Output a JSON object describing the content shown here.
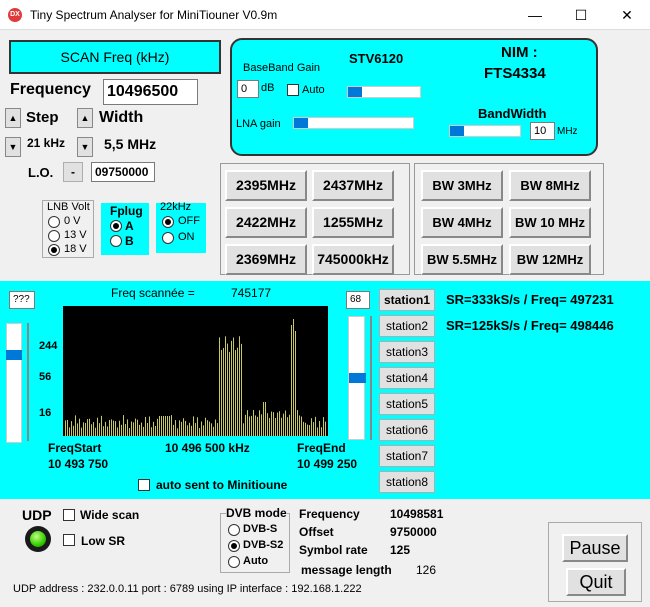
{
  "window": {
    "title": "Tiny Spectrum Analyser for MiniTiouner V0.9m",
    "icon_text": "DX",
    "minimize": "—",
    "maximize": "☐",
    "close": "✕"
  },
  "left": {
    "scan_button": "SCAN Freq (kHz)",
    "frequency_label": "Frequency",
    "frequency_value": "10496500",
    "step_label": "Step",
    "step_value": "21 kHz",
    "width_label": "Width",
    "width_value": "5,5 MHz",
    "lo_label": "L.O.",
    "lo_sign": "-",
    "lo_value": "09750000",
    "lnb_volt_label": "LNB Volt",
    "lnb_options": [
      "0 V",
      "13 V",
      "18 V"
    ],
    "lnb_selected": 2,
    "fplug_label": "Fplug",
    "fplug_options": [
      "A",
      "B"
    ],
    "fplug_selected": 0,
    "k22_label": "22kHz",
    "k22_options": [
      "OFF",
      "ON"
    ],
    "k22_selected": 0
  },
  "tuner": {
    "baseband_label": "BaseBand Gain",
    "baseband_value": "0",
    "baseband_unit": "dB",
    "auto_label": "Auto",
    "stv_label": "STV6120",
    "nim_label": "NIM :",
    "nim_value": "FTS4334",
    "lna_label": "LNA gain",
    "bandwidth_label": "BandWidth",
    "bandwidth_value": "10",
    "bandwidth_unit": "MHz",
    "baseband_slider": 0.0,
    "lna_slider": 0.0,
    "bandwidth_slider": 0.0
  },
  "freq_buttons": [
    "2395MHz",
    "2437MHz",
    "2422MHz",
    "1255MHz",
    "2369MHz",
    "745000kHz"
  ],
  "bw_buttons": [
    "BW 3MHz",
    "BW 8MHz",
    "BW 4MHz",
    "BW 10 MHz",
    "BW 5.5MHz",
    "BW 12MHz"
  ],
  "spectrum": {
    "left_value": "???",
    "freq_scan_label": "Freq scannée =",
    "freq_scan_value": "745177",
    "y_ticks": [
      "244",
      "56",
      "16"
    ],
    "right_value": "68",
    "freq_start_label": "FreqStart",
    "freq_start_value": "10 493 750",
    "center_value": "10 496 500 kHz",
    "freq_end_label": "FreqEnd",
    "freq_end_value": "10 499 250",
    "auto_sent_label": "auto sent to Minitioune",
    "stations": [
      "station1",
      "station2",
      "station3",
      "station4",
      "station5",
      "station6",
      "station7",
      "station8"
    ],
    "results": [
      "SR=333kS/s / Freq= 497231",
      "SR=125kS/s / Freq= 498446"
    ]
  },
  "bottom": {
    "udp_label": "UDP",
    "wide_scan_label": "Wide scan",
    "low_sr_label": "Low SR",
    "dvb_label": "DVB mode",
    "dvb_options": [
      "DVB-S",
      "DVB-S2",
      "Auto"
    ],
    "dvb_selected": 1,
    "info_labels": [
      "Frequency",
      "Offset",
      "Symbol rate",
      "message length"
    ],
    "info_values": [
      "10498581",
      "9750000",
      "125",
      "126"
    ],
    "pause_button": "Pause",
    "quit_button": "Quit",
    "status": "UDP address : 232.0.0.11 port : 6789 using IP interface : 192.168.1.222"
  },
  "colors": {
    "accent": "#00ffff",
    "trace": "#c8c860",
    "led": "#33cc00"
  }
}
